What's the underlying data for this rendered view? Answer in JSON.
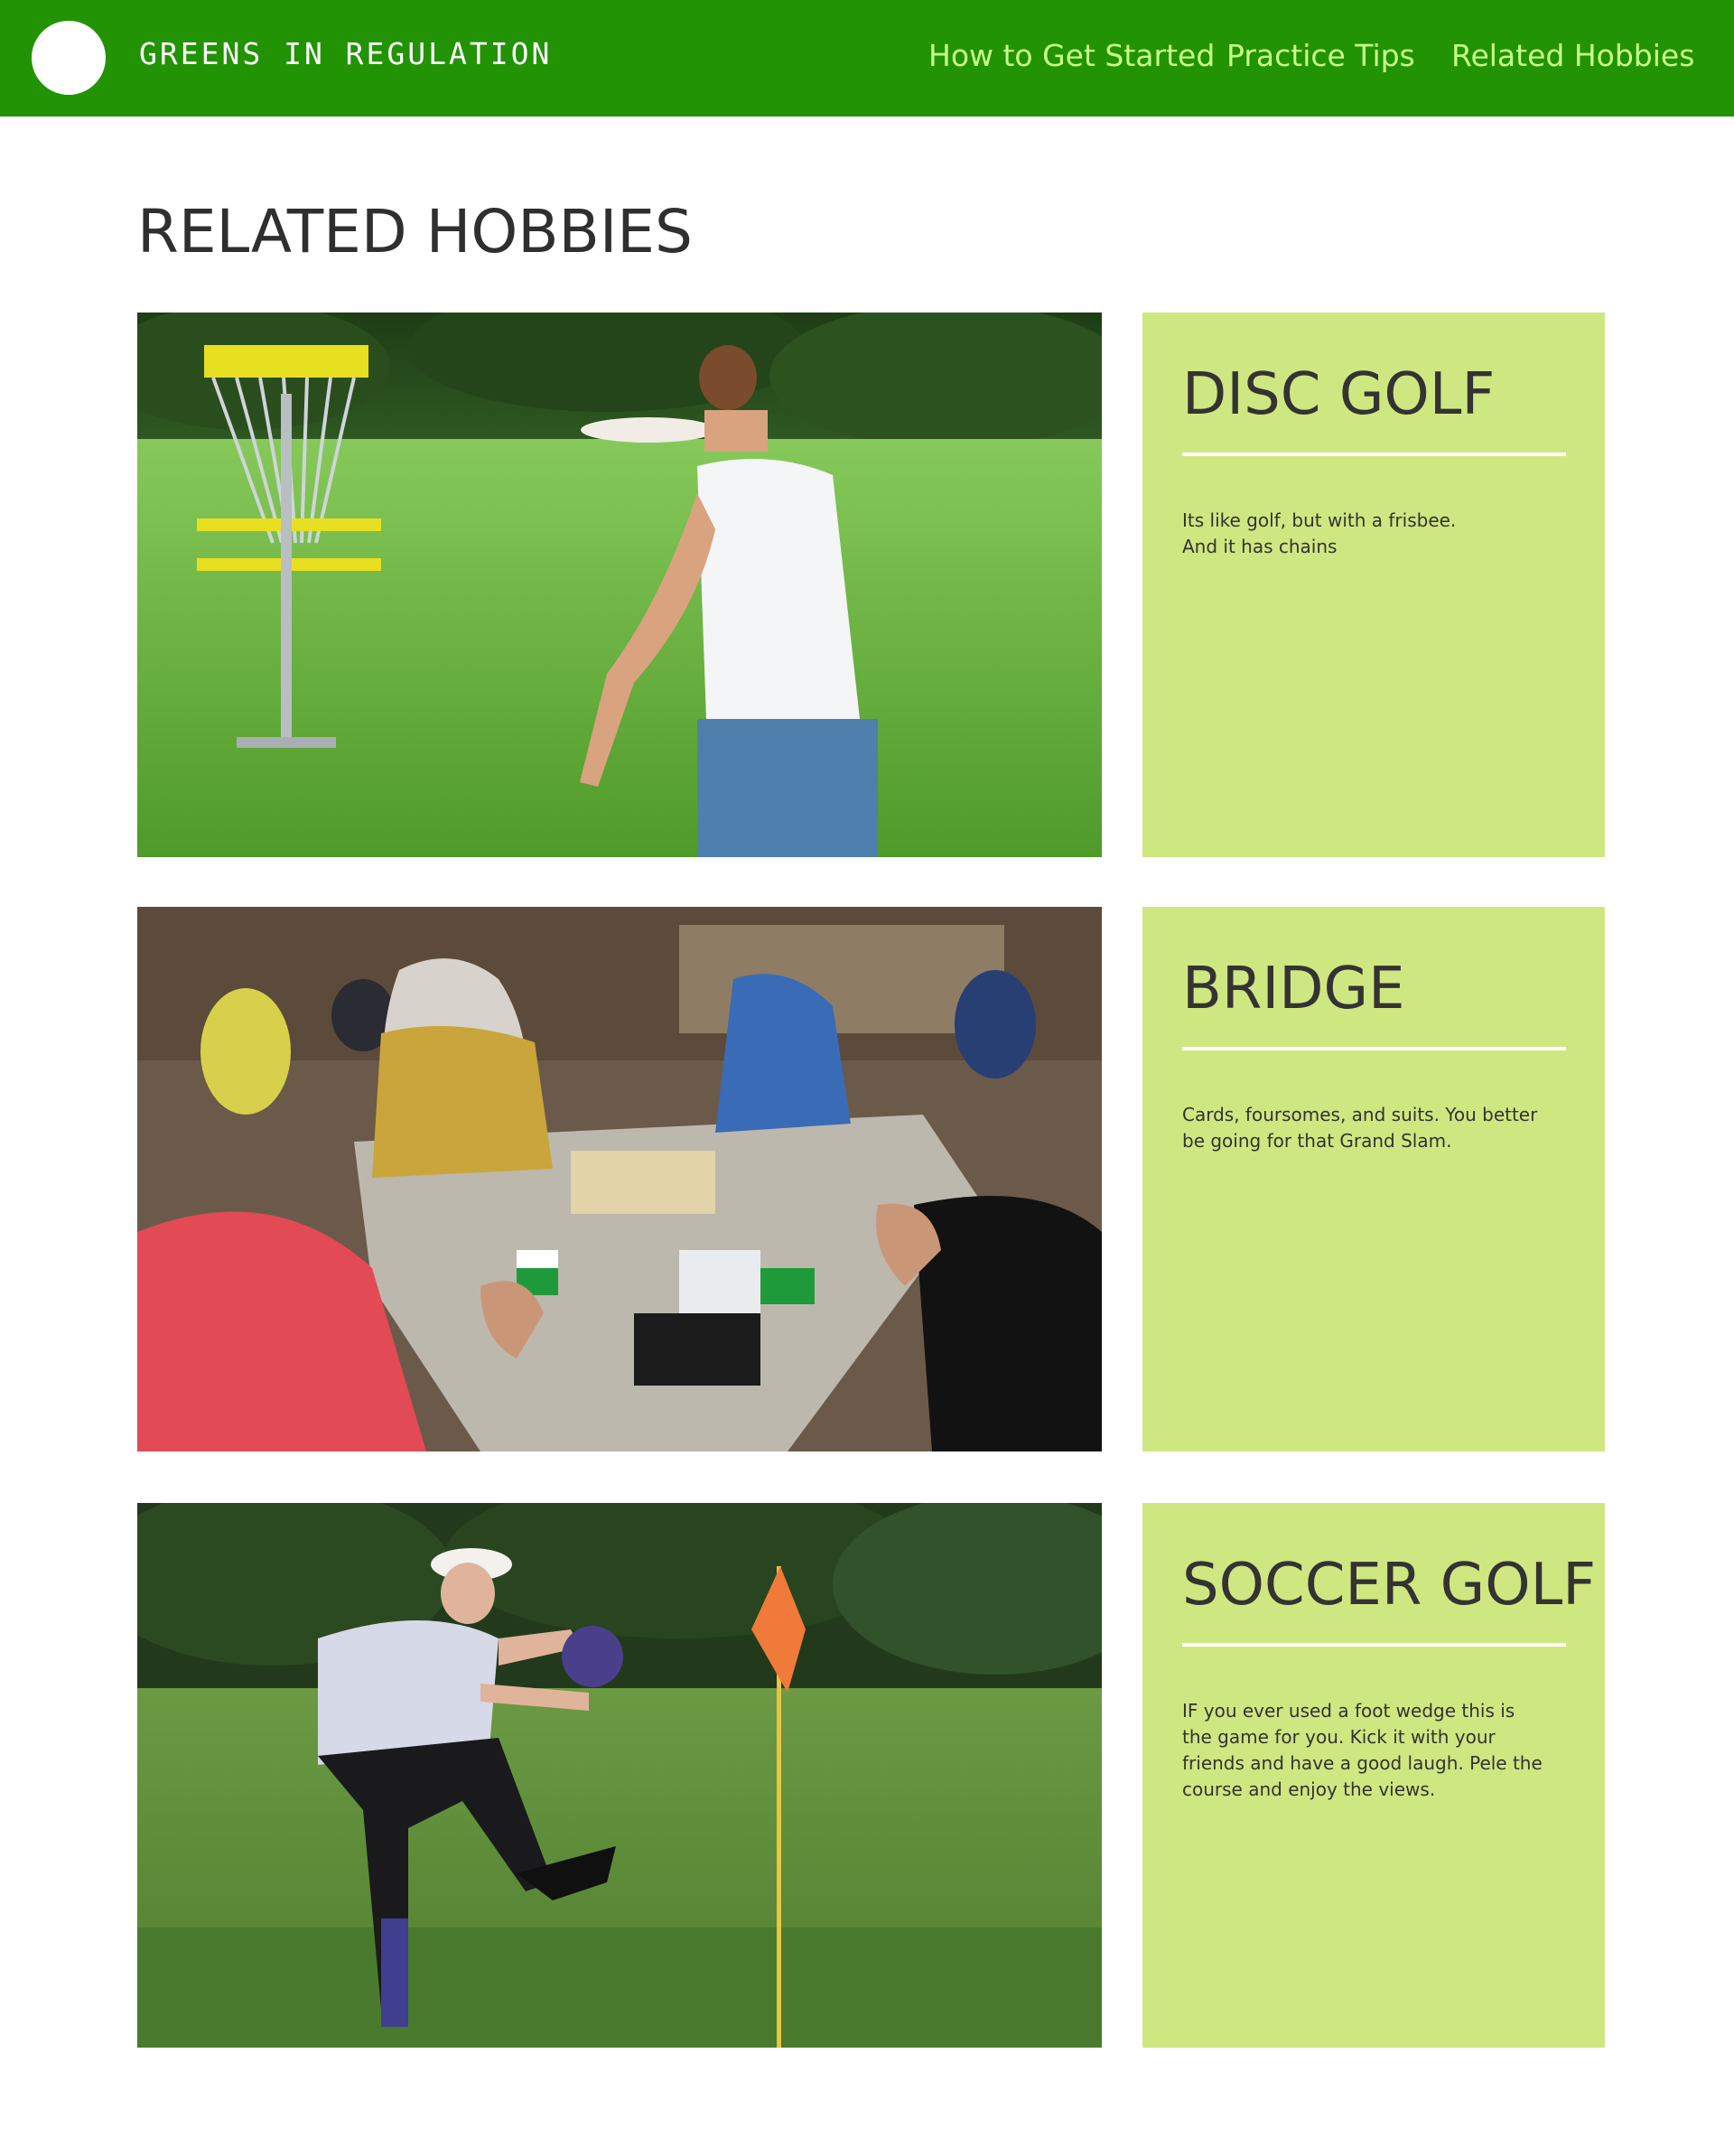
{
  "header": {
    "brand": "GREENS IN REGULATION",
    "nav": [
      {
        "label": "How to Get Started"
      },
      {
        "label": "Practice Tips"
      },
      {
        "label": "Related Hobbies"
      }
    ]
  },
  "page": {
    "title": "RELATED HOBBIES"
  },
  "hobbies": [
    {
      "title": "DISC GOLF",
      "description": "Its like golf, but with a frisbee.\nAnd it has chains"
    },
    {
      "title": "BRIDGE",
      "description": "Cards, foursomes, and suits. You better\nbe going for that Grand Slam."
    },
    {
      "title": "SOCCER GOLF",
      "description": "IF you ever used a foot wedge this is\nthe game for you. Kick it with your\nfriends and have a good laugh. Pele the\ncourse and enjoy the views."
    }
  ],
  "colors": {
    "nav_background": "#229304",
    "nav_link": "#c6ff8c",
    "card_background": "#cfe781",
    "text": "#333333"
  }
}
